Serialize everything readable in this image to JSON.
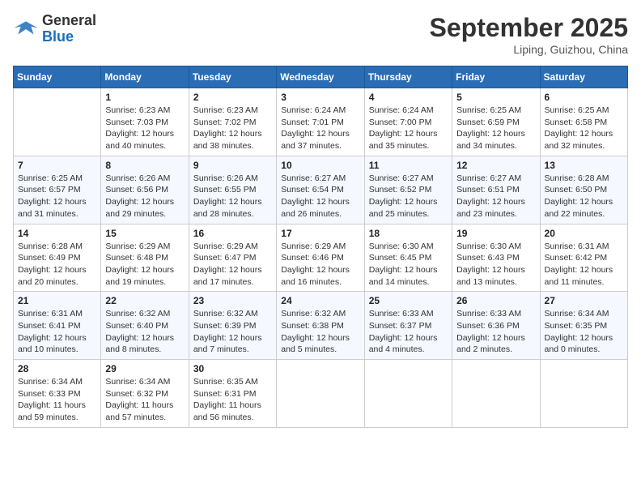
{
  "header": {
    "logo_general": "General",
    "logo_blue": "Blue",
    "month_year": "September 2025",
    "location": "Liping, Guizhou, China"
  },
  "weekdays": [
    "Sunday",
    "Monday",
    "Tuesday",
    "Wednesday",
    "Thursday",
    "Friday",
    "Saturday"
  ],
  "weeks": [
    [
      {
        "day": "",
        "info": ""
      },
      {
        "day": "1",
        "info": "Sunrise: 6:23 AM\nSunset: 7:03 PM\nDaylight: 12 hours\nand 40 minutes."
      },
      {
        "day": "2",
        "info": "Sunrise: 6:23 AM\nSunset: 7:02 PM\nDaylight: 12 hours\nand 38 minutes."
      },
      {
        "day": "3",
        "info": "Sunrise: 6:24 AM\nSunset: 7:01 PM\nDaylight: 12 hours\nand 37 minutes."
      },
      {
        "day": "4",
        "info": "Sunrise: 6:24 AM\nSunset: 7:00 PM\nDaylight: 12 hours\nand 35 minutes."
      },
      {
        "day": "5",
        "info": "Sunrise: 6:25 AM\nSunset: 6:59 PM\nDaylight: 12 hours\nand 34 minutes."
      },
      {
        "day": "6",
        "info": "Sunrise: 6:25 AM\nSunset: 6:58 PM\nDaylight: 12 hours\nand 32 minutes."
      }
    ],
    [
      {
        "day": "7",
        "info": "Sunrise: 6:25 AM\nSunset: 6:57 PM\nDaylight: 12 hours\nand 31 minutes."
      },
      {
        "day": "8",
        "info": "Sunrise: 6:26 AM\nSunset: 6:56 PM\nDaylight: 12 hours\nand 29 minutes."
      },
      {
        "day": "9",
        "info": "Sunrise: 6:26 AM\nSunset: 6:55 PM\nDaylight: 12 hours\nand 28 minutes."
      },
      {
        "day": "10",
        "info": "Sunrise: 6:27 AM\nSunset: 6:54 PM\nDaylight: 12 hours\nand 26 minutes."
      },
      {
        "day": "11",
        "info": "Sunrise: 6:27 AM\nSunset: 6:52 PM\nDaylight: 12 hours\nand 25 minutes."
      },
      {
        "day": "12",
        "info": "Sunrise: 6:27 AM\nSunset: 6:51 PM\nDaylight: 12 hours\nand 23 minutes."
      },
      {
        "day": "13",
        "info": "Sunrise: 6:28 AM\nSunset: 6:50 PM\nDaylight: 12 hours\nand 22 minutes."
      }
    ],
    [
      {
        "day": "14",
        "info": "Sunrise: 6:28 AM\nSunset: 6:49 PM\nDaylight: 12 hours\nand 20 minutes."
      },
      {
        "day": "15",
        "info": "Sunrise: 6:29 AM\nSunset: 6:48 PM\nDaylight: 12 hours\nand 19 minutes."
      },
      {
        "day": "16",
        "info": "Sunrise: 6:29 AM\nSunset: 6:47 PM\nDaylight: 12 hours\nand 17 minutes."
      },
      {
        "day": "17",
        "info": "Sunrise: 6:29 AM\nSunset: 6:46 PM\nDaylight: 12 hours\nand 16 minutes."
      },
      {
        "day": "18",
        "info": "Sunrise: 6:30 AM\nSunset: 6:45 PM\nDaylight: 12 hours\nand 14 minutes."
      },
      {
        "day": "19",
        "info": "Sunrise: 6:30 AM\nSunset: 6:43 PM\nDaylight: 12 hours\nand 13 minutes."
      },
      {
        "day": "20",
        "info": "Sunrise: 6:31 AM\nSunset: 6:42 PM\nDaylight: 12 hours\nand 11 minutes."
      }
    ],
    [
      {
        "day": "21",
        "info": "Sunrise: 6:31 AM\nSunset: 6:41 PM\nDaylight: 12 hours\nand 10 minutes."
      },
      {
        "day": "22",
        "info": "Sunrise: 6:32 AM\nSunset: 6:40 PM\nDaylight: 12 hours\nand 8 minutes."
      },
      {
        "day": "23",
        "info": "Sunrise: 6:32 AM\nSunset: 6:39 PM\nDaylight: 12 hours\nand 7 minutes."
      },
      {
        "day": "24",
        "info": "Sunrise: 6:32 AM\nSunset: 6:38 PM\nDaylight: 12 hours\nand 5 minutes."
      },
      {
        "day": "25",
        "info": "Sunrise: 6:33 AM\nSunset: 6:37 PM\nDaylight: 12 hours\nand 4 minutes."
      },
      {
        "day": "26",
        "info": "Sunrise: 6:33 AM\nSunset: 6:36 PM\nDaylight: 12 hours\nand 2 minutes."
      },
      {
        "day": "27",
        "info": "Sunrise: 6:34 AM\nSunset: 6:35 PM\nDaylight: 12 hours\nand 0 minutes."
      }
    ],
    [
      {
        "day": "28",
        "info": "Sunrise: 6:34 AM\nSunset: 6:33 PM\nDaylight: 11 hours\nand 59 minutes."
      },
      {
        "day": "29",
        "info": "Sunrise: 6:34 AM\nSunset: 6:32 PM\nDaylight: 11 hours\nand 57 minutes."
      },
      {
        "day": "30",
        "info": "Sunrise: 6:35 AM\nSunset: 6:31 PM\nDaylight: 11 hours\nand 56 minutes."
      },
      {
        "day": "",
        "info": ""
      },
      {
        "day": "",
        "info": ""
      },
      {
        "day": "",
        "info": ""
      },
      {
        "day": "",
        "info": ""
      }
    ]
  ]
}
